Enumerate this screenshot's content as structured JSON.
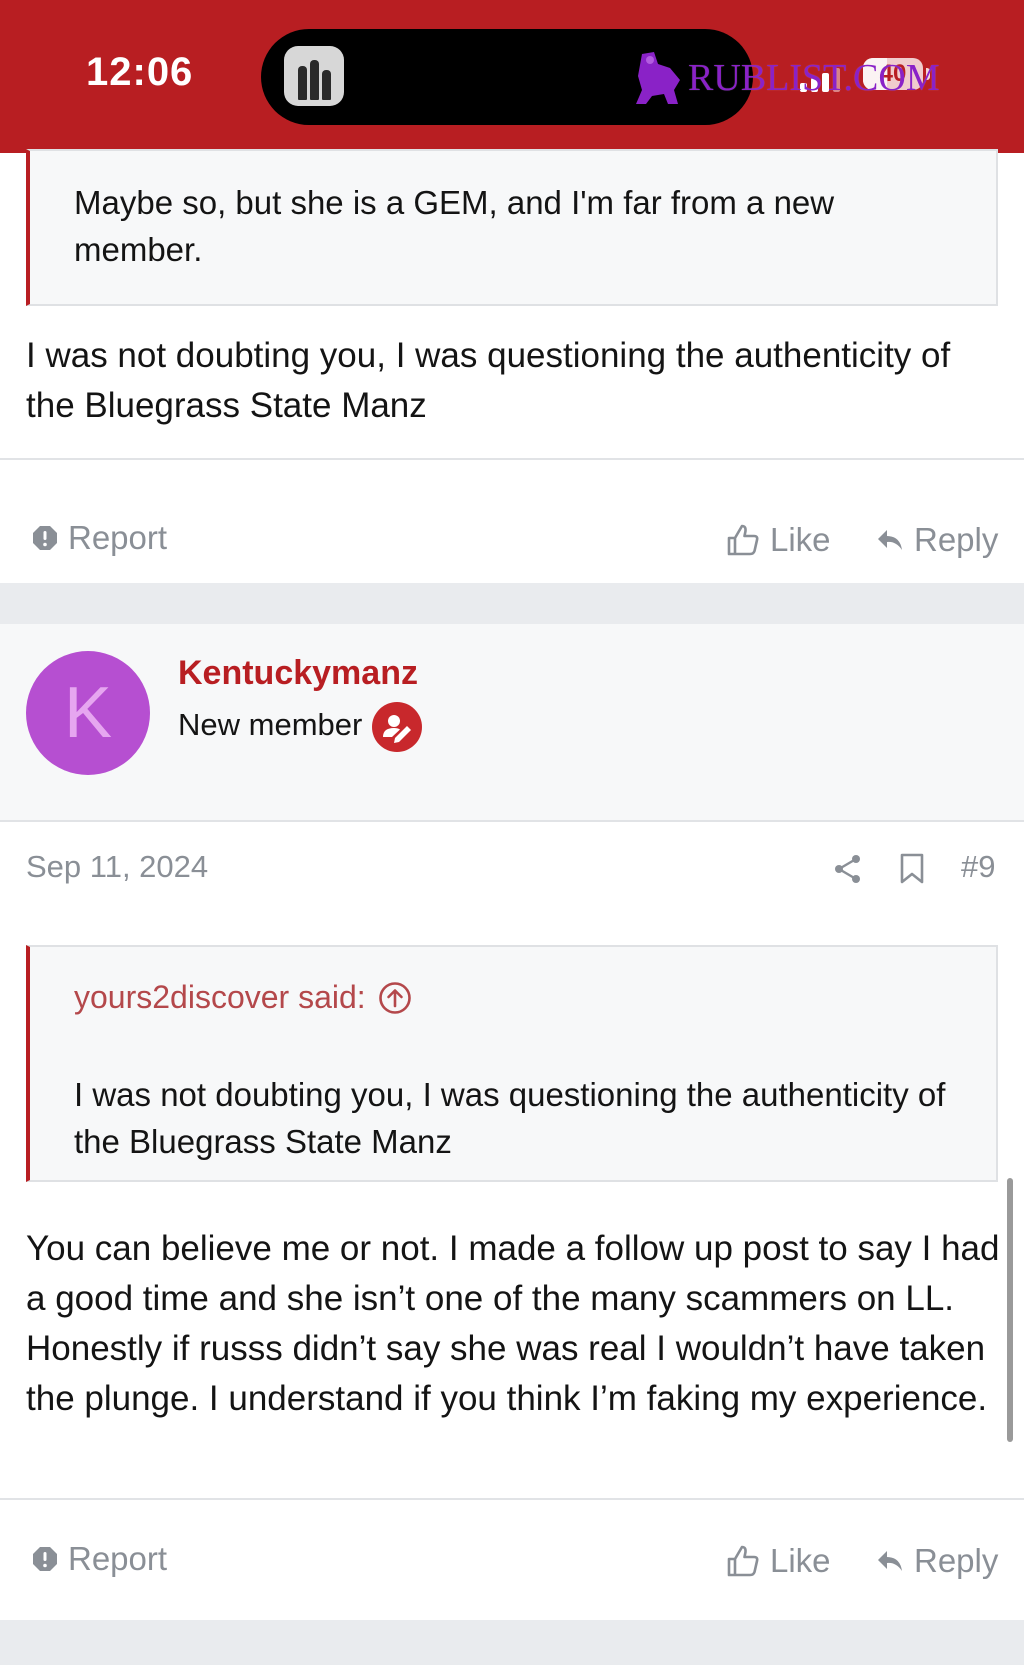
{
  "status_bar": {
    "time": "12:06",
    "battery": "40",
    "battery_level_percent": 40,
    "watermark": "RUBLIST.COM",
    "background_color": "#b81e22"
  },
  "post1": {
    "quote_text": "Maybe so, but she is a GEM, and I'm far from a new member.",
    "body": "I was not doubting you, I was questioning the authenticity of the Bluegrass State Manz",
    "actions": {
      "report": "Report",
      "like": "Like",
      "reply": "Reply"
    }
  },
  "post2": {
    "avatar_letter": "K",
    "avatar_color": "#b64fd1",
    "username": "Kentuckymanz",
    "user_title": "New member",
    "date": "Sep 11, 2024",
    "post_number": "#9",
    "quote": {
      "attribution": "yours2discover said:",
      "text": "I was not doubting you, I was questioning the authenticity of the Bluegrass State Manz"
    },
    "body": "You can believe me or not. I made a follow up post to say I had a good time and she isn’t one of the many scammers on LL. Honestly if russs didn’t say she was real I wouldn’t have taken the plunge. I understand if you think I’m faking my experience.",
    "actions": {
      "report": "Report",
      "like": "Like",
      "reply": "Reply"
    }
  },
  "icons": {
    "report": "report-icon",
    "like": "thumbs-up-icon",
    "reply": "reply-arrow-icon",
    "share": "share-icon",
    "bookmark": "bookmark-icon",
    "quote_jump": "arrow-up-circle-icon",
    "user_badge": "user-pen-icon"
  },
  "colors": {
    "accent": "#b81e22",
    "muted_text": "#8a8f96",
    "quote_attrib": "#b4484b"
  }
}
